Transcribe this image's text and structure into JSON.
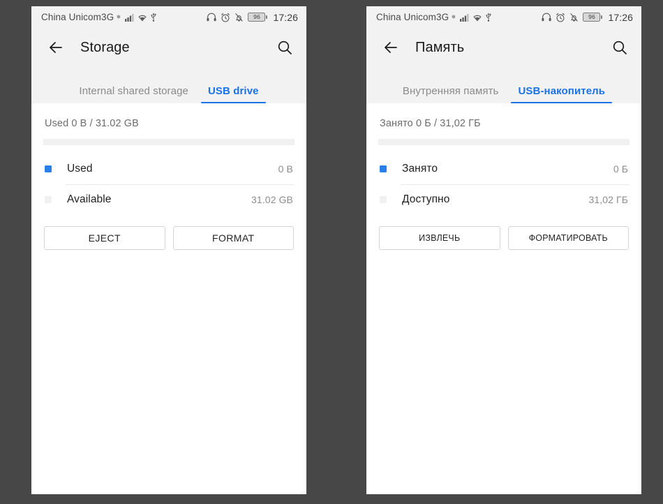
{
  "colors": {
    "accent": "#1b72e8",
    "used_swatch": "#2b80e8",
    "available_swatch": "#f1f1f2",
    "page_background": "#474747",
    "chrome_background": "#f2f2f2",
    "content_background": "#ffffff"
  },
  "panels": [
    {
      "id": "english",
      "status_bar": {
        "carrier": "China Unicom3G",
        "network_icons": [
          "roaming-asterisk-icon",
          "signal-bars-icon",
          "wifi-icon",
          "usb-icon"
        ],
        "tray_icons": [
          "headphones-icon",
          "alarm-clock-icon",
          "notifications-off-icon"
        ],
        "battery_level": "96",
        "time": "17:26"
      },
      "appbar": {
        "back_icon": "back-arrow-icon",
        "title": "Storage",
        "search_icon": "search-icon"
      },
      "tabs": [
        {
          "label": "Internal shared storage",
          "active": false
        },
        {
          "label": "USB drive",
          "active": true
        }
      ],
      "storage": {
        "summary": "Used 0 B / 31.02 GB",
        "progress_percent": 0,
        "rows": [
          {
            "label": "Used",
            "value": "0 B",
            "swatch": "used"
          },
          {
            "label": "Available",
            "value": "31.02 GB",
            "swatch": "available"
          }
        ]
      },
      "actions": [
        {
          "label": "EJECT"
        },
        {
          "label": "FORMAT"
        }
      ]
    },
    {
      "id": "russian",
      "status_bar": {
        "carrier": "China Unicom3G",
        "network_icons": [
          "roaming-asterisk-icon",
          "signal-bars-icon",
          "wifi-icon",
          "usb-icon"
        ],
        "tray_icons": [
          "headphones-icon",
          "alarm-clock-icon",
          "notifications-off-icon"
        ],
        "battery_level": "96",
        "time": "17:26"
      },
      "appbar": {
        "back_icon": "back-arrow-icon",
        "title": "Память",
        "search_icon": "search-icon"
      },
      "tabs": [
        {
          "label": "Внутренняя память",
          "active": false
        },
        {
          "label": "USB-накопитель",
          "active": true
        }
      ],
      "storage": {
        "summary": "Занято 0 Б / 31,02 ГБ",
        "progress_percent": 0,
        "rows": [
          {
            "label": "Занято",
            "value": "0 Б",
            "swatch": "used"
          },
          {
            "label": "Доступно",
            "value": "31,02 ГБ",
            "swatch": "available"
          }
        ]
      },
      "actions": [
        {
          "label": "ИЗВЛЕЧЬ"
        },
        {
          "label": "ФОРМАТИРОВАТЬ"
        }
      ]
    }
  ]
}
